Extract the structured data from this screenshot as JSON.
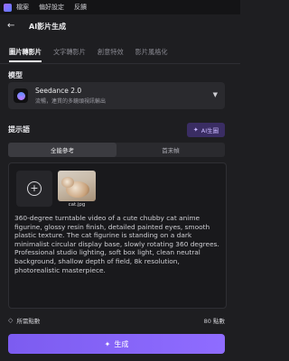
{
  "menubar": {
    "items": [
      "檔案",
      "偏好設定",
      "反饋"
    ]
  },
  "header": {
    "title": "AI影片生成"
  },
  "tabs": [
    "圖片轉影片",
    "文字轉影片",
    "創意特效",
    "影片風格化"
  ],
  "model": {
    "section_label": "模型",
    "name": "Seedance 2.0",
    "description": "流暢，連貫的多鏡頭視訊輸出"
  },
  "prompt": {
    "section_label": "提示語",
    "ai_button_label": "AI生圖",
    "segments": [
      "全能參考",
      "首末幀"
    ],
    "image_name": "cat.jpg",
    "text": "360-degree turntable video of a cute chubby cat anime figurine, glossy resin finish, detailed painted eyes, smooth plastic texture. The cat figurine is standing on a dark minimalist circular display base, slowly rotating 360 degrees. Professional studio lighting, soft box light, clean neutral background, shallow depth of field, 8k resolution, photorealistic masterpiece."
  },
  "cost": {
    "label": "所需點數",
    "value": "80 點數"
  },
  "generate_button": {
    "label": "生成"
  },
  "colors": {
    "accent": "#8a63ff",
    "background": "#1e1e21"
  }
}
